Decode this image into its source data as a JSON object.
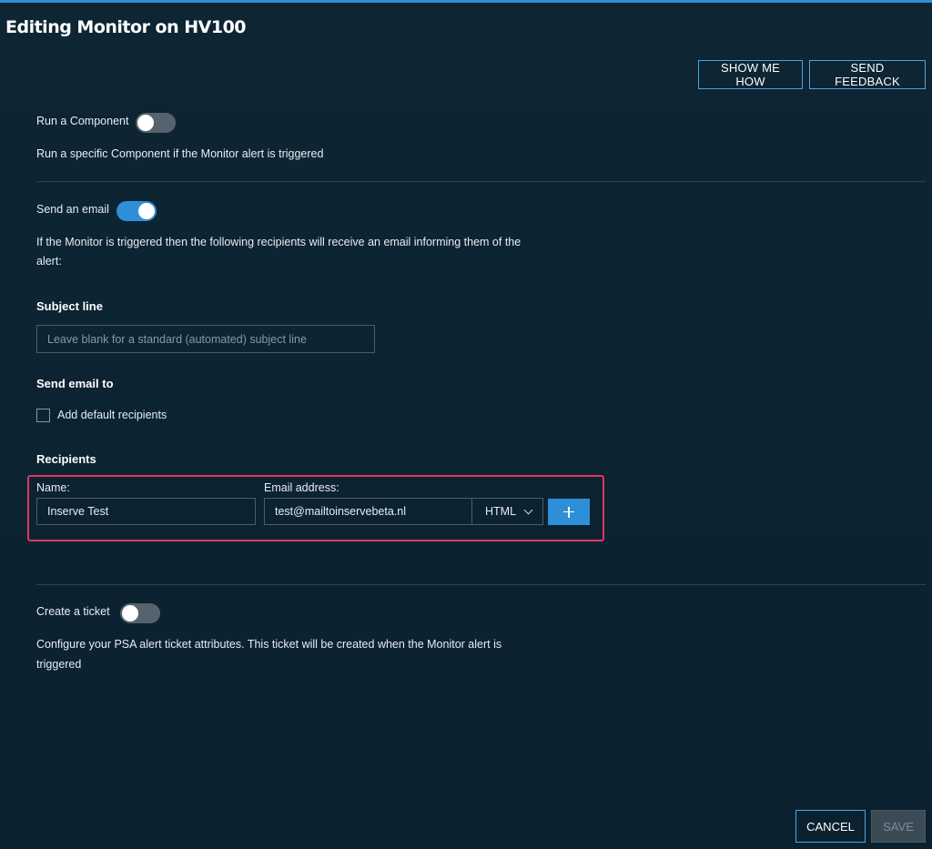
{
  "page": {
    "title": "Editing Monitor on HV100"
  },
  "header": {
    "show_me_how": "SHOW ME HOW",
    "send_feedback": "SEND FEEDBACK"
  },
  "run_component": {
    "label": "Run a Component",
    "enabled": false,
    "description": "Run a specific Component if the Monitor alert is triggered"
  },
  "send_email": {
    "label": "Send an email",
    "enabled": true,
    "description_line1": "If the Monitor is triggered then the following recipients will receive an email informing them of the",
    "description_line2": "alert:",
    "subject_heading": "Subject line",
    "subject_placeholder": "Leave blank for a standard (automated) subject line",
    "subject_value": "",
    "send_to_heading": "Send email to",
    "default_recipients_label": "Add default recipients",
    "default_recipients_checked": false,
    "recipients_heading": "Recipients",
    "name_label": "Name:",
    "name_value": "Inserve Test",
    "email_label": "Email address:",
    "email_value": "test@mailtoinservebeta.nl",
    "format_value": "HTML"
  },
  "create_ticket": {
    "label": "Create a ticket",
    "enabled": false,
    "description_line1": "Configure your PSA alert ticket attributes. This ticket will be created when the Monitor alert is",
    "description_line2": "triggered"
  },
  "footer": {
    "cancel": "CANCEL",
    "save": "SAVE"
  },
  "colors": {
    "background": "#0c2230",
    "accent": "#2e8fd8",
    "highlight_border": "#e0355f"
  }
}
